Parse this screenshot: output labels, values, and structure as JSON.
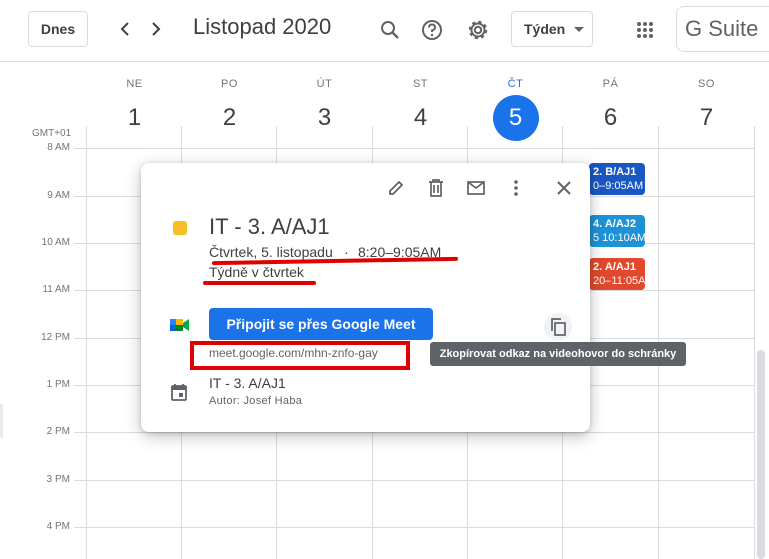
{
  "header": {
    "today_label": "Dnes",
    "month_title": "Listopad 2020",
    "view_label": "Týden",
    "brand": "G Suite"
  },
  "days": [
    {
      "name": "NE",
      "num": "1"
    },
    {
      "name": "PO",
      "num": "2"
    },
    {
      "name": "ÚT",
      "num": "3"
    },
    {
      "name": "ST",
      "num": "4"
    },
    {
      "name": "ČT",
      "num": "5"
    },
    {
      "name": "PÁ",
      "num": "6"
    },
    {
      "name": "SO",
      "num": "7"
    }
  ],
  "timezone": "GMT+01",
  "hours": [
    "8 AM",
    "9 AM",
    "10 AM",
    "11 AM",
    "12 PM",
    "1 PM",
    "2 PM",
    "3 PM",
    "4 PM"
  ],
  "events": [
    {
      "title": "2. B/AJ1",
      "time": "0–9:05AM",
      "color": "#1a57c3"
    },
    {
      "title": "4. A/AJ2",
      "time": "5  10:10AM",
      "color": "#1c93d8"
    },
    {
      "title": "2. A/AJ1",
      "time": "20–11:05A",
      "color": "#e2482b"
    }
  ],
  "popup": {
    "title": "IT - 3. A/AJ1",
    "date": "Čtvrtek, 5. listopadu",
    "separator": "·",
    "time": "8:20–9:05AM",
    "recurrence": "Týdně v čtvrtek",
    "meet_button": "Připojit se přes Google Meet",
    "meet_link": "meet.google.com/mhn-znfo-gay",
    "calendar_name": "IT - 3. A/AJ1",
    "author": "Autor: Josef Haba",
    "event_color": "#f6bf26"
  },
  "tooltip": "Zkopírovat odkaz na videohovor do schránky"
}
